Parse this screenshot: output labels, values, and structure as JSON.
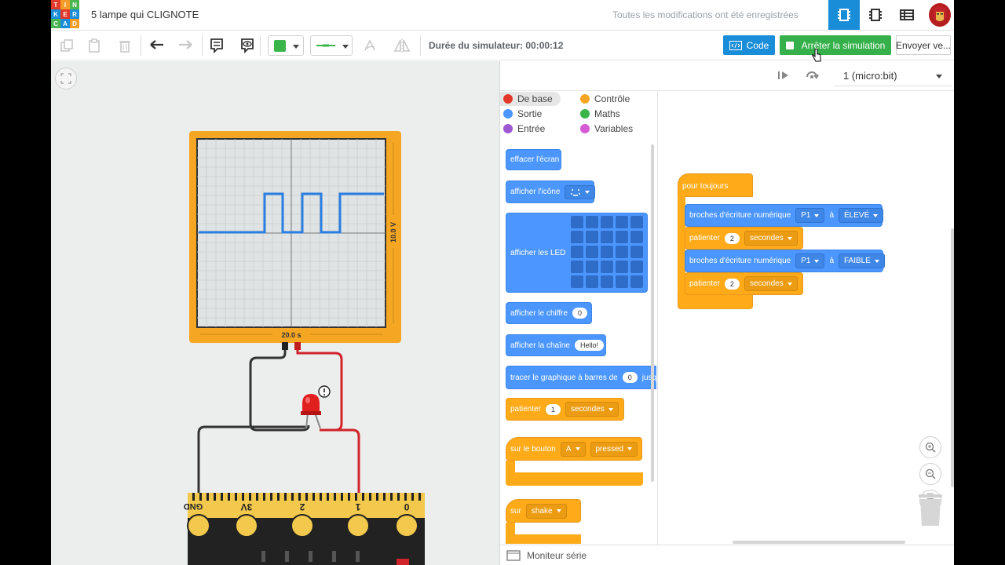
{
  "app": {
    "doc_title": "5 lampe qui CLIGNOTE",
    "save_status": "Toutes les modifications ont été enregistrées",
    "logo_letters": [
      "T",
      "I",
      "N",
      "K",
      "E",
      "R",
      "C",
      "A",
      "D"
    ],
    "logo_colors": [
      "#e2382a",
      "#f39c28",
      "#49b64f",
      "#1a8dd8",
      "#e2382a",
      "#1a8dd8",
      "#49b64f",
      "#1a8dd8",
      "#f39c28"
    ]
  },
  "toolbar": {
    "sim_duration": "Durée du simulateur: 00:00:12",
    "code_label": "Code",
    "stop_label": "Arrêter la simulation",
    "send_label": "Envoyer ve...",
    "fill_color": "#3ab54a"
  },
  "oscilloscope": {
    "x_label": "20.0 s",
    "y_label": "10.0 V"
  },
  "board": {
    "pins": [
      "GND",
      "3V",
      "2",
      "1",
      "0"
    ]
  },
  "code_panel": {
    "device": "1 (micro:bit)",
    "categories": [
      {
        "label": "De base",
        "color": "#e2382a"
      },
      {
        "label": "Contrôle",
        "color": "#f5a623"
      },
      {
        "label": "Sortie",
        "color": "#4c97ff"
      },
      {
        "label": "Maths",
        "color": "#3ab54a"
      },
      {
        "label": "Entrée",
        "color": "#9c59d1"
      },
      {
        "label": "Variables",
        "color": "#d65cd6"
      }
    ],
    "palette": {
      "clear_screen": "effacer l'écran",
      "show_icon": "afficher l'icône",
      "show_leds": "afficher les LED",
      "show_number": "afficher le chiffre",
      "show_number_value": "0",
      "show_string": "afficher la chaîne",
      "show_string_value": "Hello!",
      "plot_bar": "tracer le graphique à barres de",
      "plot_bar_value": "0",
      "plot_bar_suffix": "jusq",
      "wait": "patienter",
      "wait_value": "1",
      "wait_unit": "secondes",
      "on_button": "sur le bouton",
      "on_button_btn": "A",
      "on_button_event": "pressed",
      "on_gesture": "sur",
      "on_gesture_value": "shake"
    },
    "program": {
      "forever": "pour toujours",
      "write1_label": "broches d'écriture numérique",
      "write1_pin": "P1",
      "write1_to": "à",
      "write1_value": "ÉLEVÉ",
      "wait1_label": "patienter",
      "wait1_value": "2",
      "wait1_unit": "secondes",
      "write2_label": "broches d'écriture numérique",
      "write2_pin": "P1",
      "write2_to": "à",
      "write2_value": "FAIBLE",
      "wait2_label": "patienter",
      "wait2_value": "2",
      "wait2_unit": "secondes"
    },
    "serial_monitor": "Moniteur série"
  }
}
